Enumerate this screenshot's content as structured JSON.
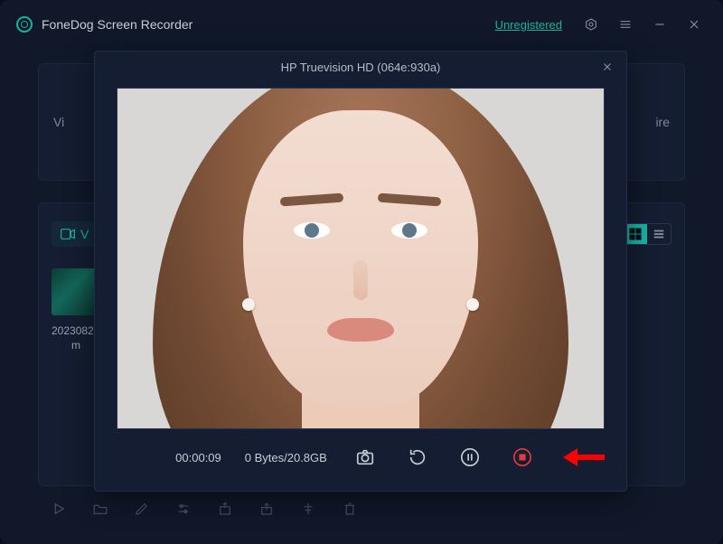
{
  "titlebar": {
    "app_name": "FoneDog Screen Recorder",
    "unregistered_label": "Unregistered"
  },
  "panels": {
    "left_label": "Vi",
    "right_label": "ire"
  },
  "library": {
    "tab_label": "V",
    "file_label_line1": "2023082",
    "file_label_line2": "m"
  },
  "modal": {
    "title": "HP Truevision HD (064e:930a)",
    "elapsed": "00:00:09",
    "size_status": "0 Bytes/20.8GB"
  }
}
